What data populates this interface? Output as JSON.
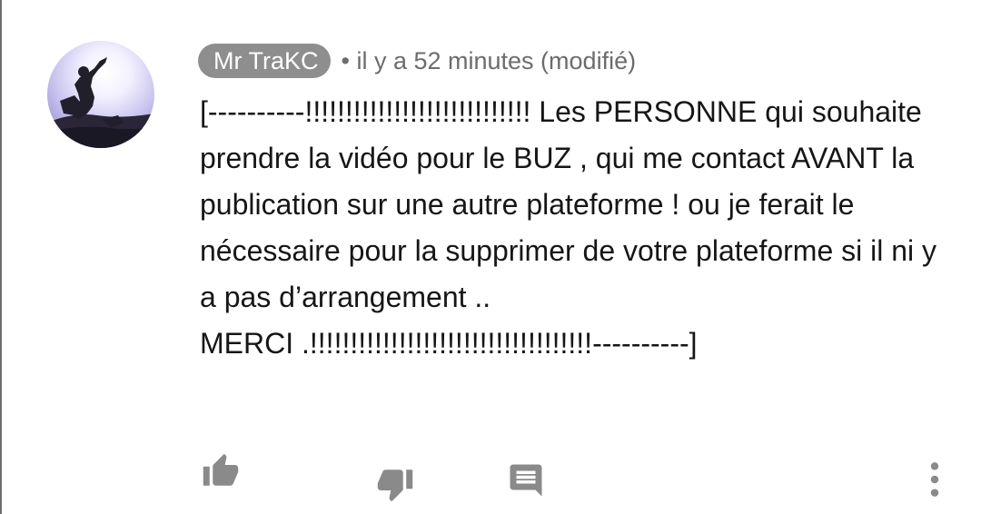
{
  "comment": {
    "author": "Mr TraKC",
    "meta": "• il y a 52 minutes (modifié)",
    "text": "[----------!!!!!!!!!!!!!!!!!!!!!!!!!!!! Les PERSONNE qui souhaite prendre la vidéo pour le BUZ , qui me contact AVANT la publication sur une autre plateforme ! ou je ferait le nécessaire pour la supprimer de votre plateforme si il ni y a pas d’arrangement ..\nMERCI .!!!!!!!!!!!!!!!!!!!!!!!!!!!!!!!!!!!----------]"
  },
  "actions": {
    "like_icon": "thumb-up-icon",
    "dislike_icon": "thumb-down-icon",
    "reply_icon": "comment-icon",
    "more_icon": "more-vertical-icon"
  },
  "colors": {
    "chip_background": "#8e8e8e",
    "icon_gray": "#8a8a8a",
    "text": "#161616",
    "meta_text": "#6c6c6c"
  }
}
